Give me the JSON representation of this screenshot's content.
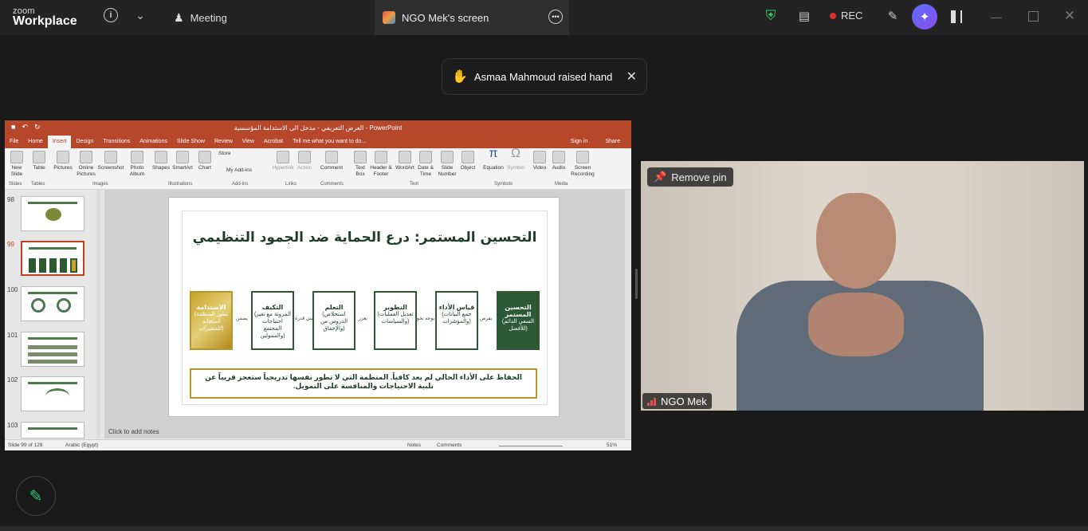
{
  "topbar": {
    "logo_line1": "zoom",
    "logo_line2": "Workplace",
    "meeting_label": "Meeting",
    "screen_tab_label": "NGO Mek's screen",
    "rec_label": "REC",
    "colors": {
      "shield": "#2ecc71",
      "rec_dot": "#e02d2d",
      "ai_button": "#6a5cf3"
    }
  },
  "notification": {
    "text": "Asmaa Mahmoud raised hand"
  },
  "ppt": {
    "window_title": "العرض التعريفي - مدخل الى الاستدامة المؤسسية - PowerPoint",
    "tabs": [
      "File",
      "Home",
      "Insert",
      "Design",
      "Transitions",
      "Animations",
      "Slide Show",
      "Review",
      "View",
      "Acrobat"
    ],
    "tell_me": "Tell me what you want to do...",
    "sign_in": "Sign in",
    "share": "Share",
    "ribbon": {
      "new_slide": "New Slide",
      "table": "Table",
      "pictures": "Pictures",
      "online_pictures": "Online Pictures",
      "screenshot": "Screenshot",
      "photo_album": "Photo Album",
      "shapes": "Shapes",
      "smartart": "SmartArt",
      "chart": "Chart",
      "store": "Store",
      "my_addins": "My Add-ins",
      "hyperlink": "Hyperlink",
      "action": "Action",
      "comment": "Comment",
      "text_box": "Text Box",
      "header_footer": "Header & Footer",
      "wordart": "WordArt",
      "date_time": "Date & Time",
      "slide_number": "Slide Number",
      "object": "Object",
      "equation": "Equation",
      "symbol": "Symbol",
      "video": "Video",
      "audio": "Audio",
      "screen_recording": "Screen Recording",
      "groups": [
        "Slides",
        "Tables",
        "Images",
        "Illustrations",
        "Add-ins",
        "Links",
        "Comments",
        "Text",
        "Symbols",
        "Media"
      ]
    },
    "thumb_numbers": [
      "98",
      "99",
      "100",
      "101",
      "102",
      "103"
    ],
    "slide": {
      "title": "التحسين المستمر: درع الحماية ضد الجمود التنظيمي",
      "boxes": [
        {
          "title": "التحسين المستمر",
          "sub": "(السعي الدائم للأفضل)"
        },
        {
          "title": "قياس الأداء",
          "sub": "(جمع البيانات والمؤشرات)"
        },
        {
          "title": "التطوير",
          "sub": "(تعديل العمليات والسياسات)"
        },
        {
          "title": "التعلم",
          "sub": "(استخلاص الدروس من والإخفاق)"
        },
        {
          "title": "التكيف",
          "sub": "(المرونة مع تغير احتياجات المجتمع والممولين)"
        },
        {
          "title": "الاستدامة",
          "sub": "(تطور المنظمة استجابة للمتغيرات)"
        }
      ],
      "arrows": [
        "يفرض",
        "يوجه نحو",
        "يعزز",
        "يبني قدرة",
        "يضمن"
      ],
      "quote": "الحفاظ على الأداء الحالي لم يعد كافياً. المنظمة التي لا تطور نفسها تدريجياً ستعجز قريباً عن تلبية الاحتياجات والمنافسة على التمويل."
    },
    "notes_placeholder": "Click to add notes",
    "status": {
      "slide_of": "Slide 99 of 128",
      "language": "Arabic (Egypt)",
      "notes": "Notes",
      "comments": "Comments",
      "zoom": "51%"
    }
  },
  "video": {
    "remove_pin": "Remove pin",
    "participant_name": "NGO Mek"
  }
}
